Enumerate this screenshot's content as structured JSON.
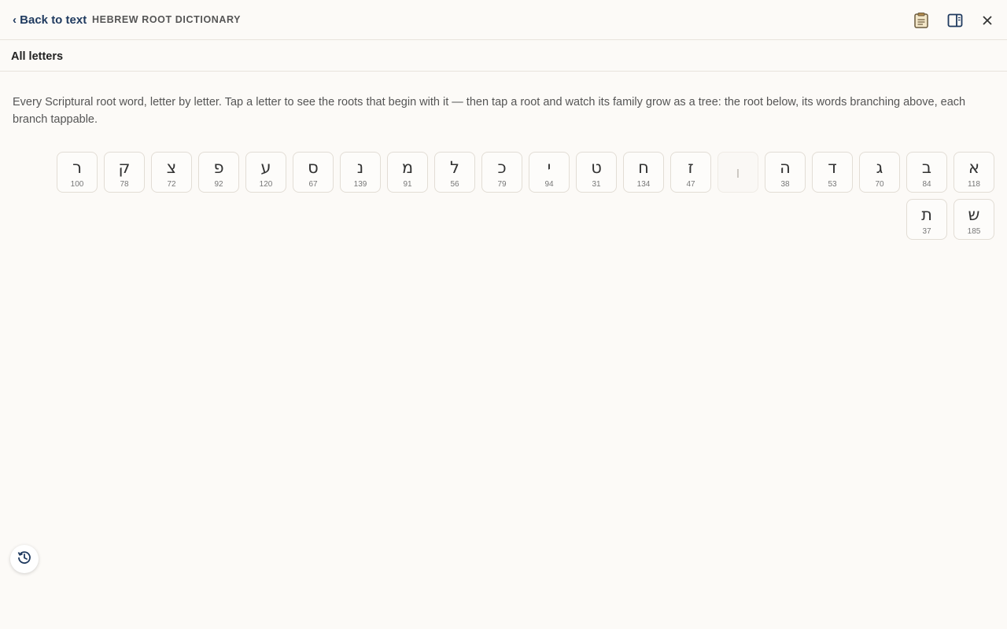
{
  "header": {
    "back_label": "‹ Back to text",
    "title": "HEBREW ROOT DICTIONARY",
    "icons": [
      "notes-icon",
      "sidebar-panel-icon",
      "close-icon"
    ]
  },
  "subheader": {
    "label": "All letters"
  },
  "intro": "Every Scriptural root word, letter by letter. Tap a letter to see the roots that begin with it — then tap a root and watch its family grow as a tree: the root below, its words branching above, each branch tappable.",
  "letters": [
    {
      "letter": "א",
      "count": "118"
    },
    {
      "letter": "ב",
      "count": "84"
    },
    {
      "letter": "ג",
      "count": "70"
    },
    {
      "letter": "ד",
      "count": "53"
    },
    {
      "letter": "ה",
      "count": "38"
    },
    {
      "letter": "ו",
      "count": "",
      "disabled": true
    },
    {
      "letter": "ז",
      "count": "47"
    },
    {
      "letter": "ח",
      "count": "134"
    },
    {
      "letter": "ט",
      "count": "31"
    },
    {
      "letter": "י",
      "count": "94"
    },
    {
      "letter": "כ",
      "count": "79"
    },
    {
      "letter": "ל",
      "count": "56"
    },
    {
      "letter": "מ",
      "count": "91"
    },
    {
      "letter": "נ",
      "count": "139"
    },
    {
      "letter": "ס",
      "count": "67"
    },
    {
      "letter": "ע",
      "count": "120"
    },
    {
      "letter": "פ",
      "count": "92"
    },
    {
      "letter": "צ",
      "count": "72"
    },
    {
      "letter": "ק",
      "count": "78"
    },
    {
      "letter": "ר",
      "count": "100"
    },
    {
      "letter": "ש",
      "count": "185"
    },
    {
      "letter": "ת",
      "count": "37"
    }
  ],
  "floating": {
    "icon": "history-icon"
  },
  "colors": {
    "accent": "#1f3a5f",
    "background": "#fcfaf7",
    "border": "#e2ddd5"
  }
}
